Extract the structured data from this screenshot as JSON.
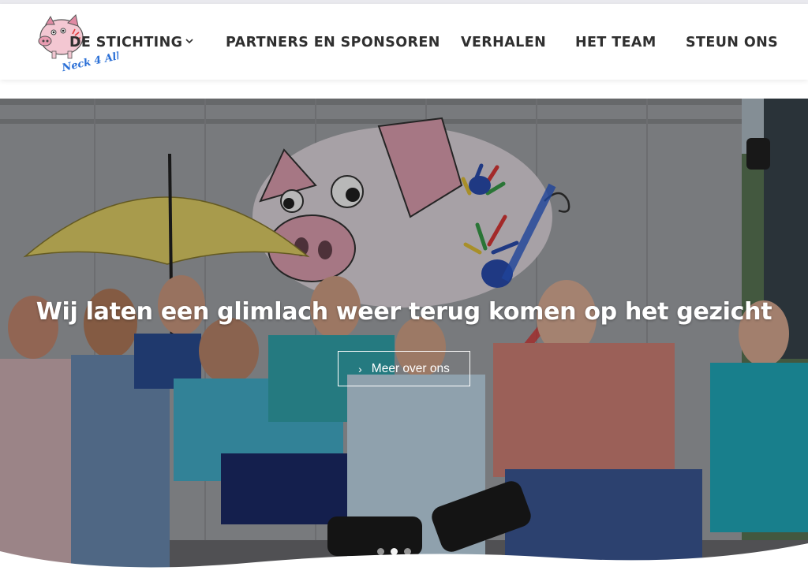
{
  "header": {
    "logo_alt": "Stichting Neck4All logo",
    "logo_text": "Neck 4 All",
    "nav": [
      {
        "label": "DE STICHTING",
        "has_dropdown": true
      },
      {
        "label": "PARTNERS EN SPONSOREN",
        "has_dropdown": false
      },
      {
        "label": "VERHALEN",
        "has_dropdown": false
      },
      {
        "label": "HET TEAM",
        "has_dropdown": false
      },
      {
        "label": "STEUN ONS",
        "has_dropdown": false
      }
    ]
  },
  "hero": {
    "title": "Wij laten een glimlach weer terug komen op het gezicht",
    "button_label": "Meer over ons",
    "button_icon": "chevron-right-icon",
    "slide_count": 3,
    "active_slide": 2
  },
  "colors": {
    "nav_text": "#2f2f2f",
    "hero_text": "#ffffff",
    "pig_pink": "#e7a6b7",
    "umbrella": "#e9d76a",
    "shirt_teal": "#3fb3c4"
  }
}
